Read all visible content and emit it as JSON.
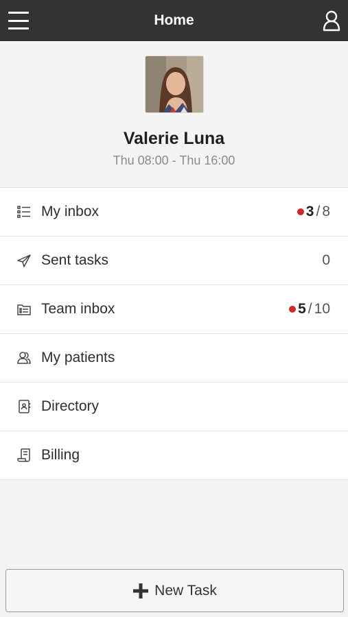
{
  "header": {
    "title": "Home"
  },
  "profile": {
    "name": "Valerie Luna",
    "shift": "Thu 08:00 - Thu 16:00"
  },
  "menu": {
    "items": [
      {
        "label": "My inbox",
        "icon": "list-icon",
        "unread": "3",
        "separator": "/",
        "total": "8"
      },
      {
        "label": "Sent tasks",
        "icon": "paper-plane-icon",
        "total": "0"
      },
      {
        "label": "Team inbox",
        "icon": "folder-list-icon",
        "unread": "5",
        "separator": "/",
        "total": "10"
      },
      {
        "label": "My patients",
        "icon": "people-icon"
      },
      {
        "label": "Directory",
        "icon": "address-book-icon"
      },
      {
        "label": "Billing",
        "icon": "receipt-icon"
      }
    ]
  },
  "footer": {
    "new_task_label": "New Task"
  },
  "colors": {
    "topbar": "#333333",
    "unread_dot": "#cc2a22"
  }
}
